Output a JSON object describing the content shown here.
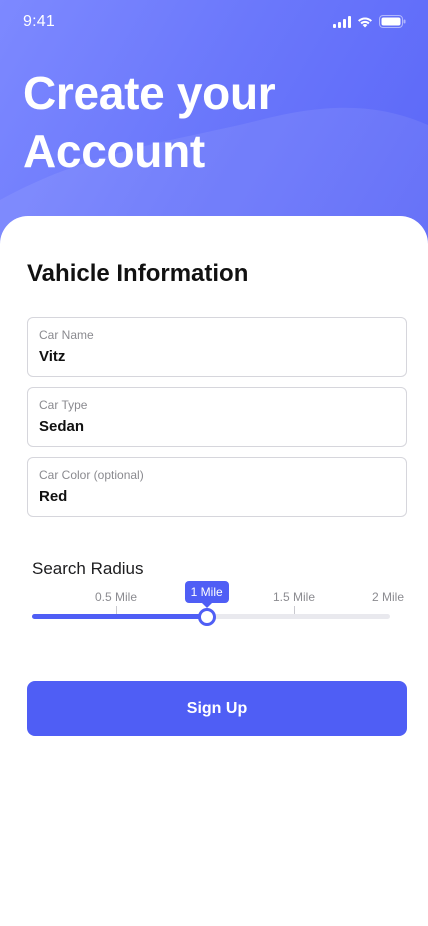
{
  "status_bar": {
    "time": "9:41",
    "icons": [
      "signal-icon",
      "wifi-icon",
      "battery-icon"
    ]
  },
  "header": {
    "title_line1": "Create your",
    "title_line2": "Account"
  },
  "section": {
    "title": "Vahicle Information"
  },
  "fields": [
    {
      "label": "Car Name",
      "value": "Vitz"
    },
    {
      "label": "Car Type",
      "value": "Sedan"
    },
    {
      "label": "Car Color (optional)",
      "value": "Red"
    }
  ],
  "search_radius": {
    "title": "Search Radius",
    "tick_labels": [
      "0.5 Mile",
      "1.5 Mile",
      "2 Mile"
    ],
    "selected_label": "1 Mile",
    "selected_value_miles": 1,
    "max_miles": 2
  },
  "signup_button": {
    "label": "Sign Up"
  },
  "colors": {
    "accent": "#4f5ef5",
    "header_gradient_start": "#7d89ff",
    "header_gradient_end": "#5a66f8"
  }
}
